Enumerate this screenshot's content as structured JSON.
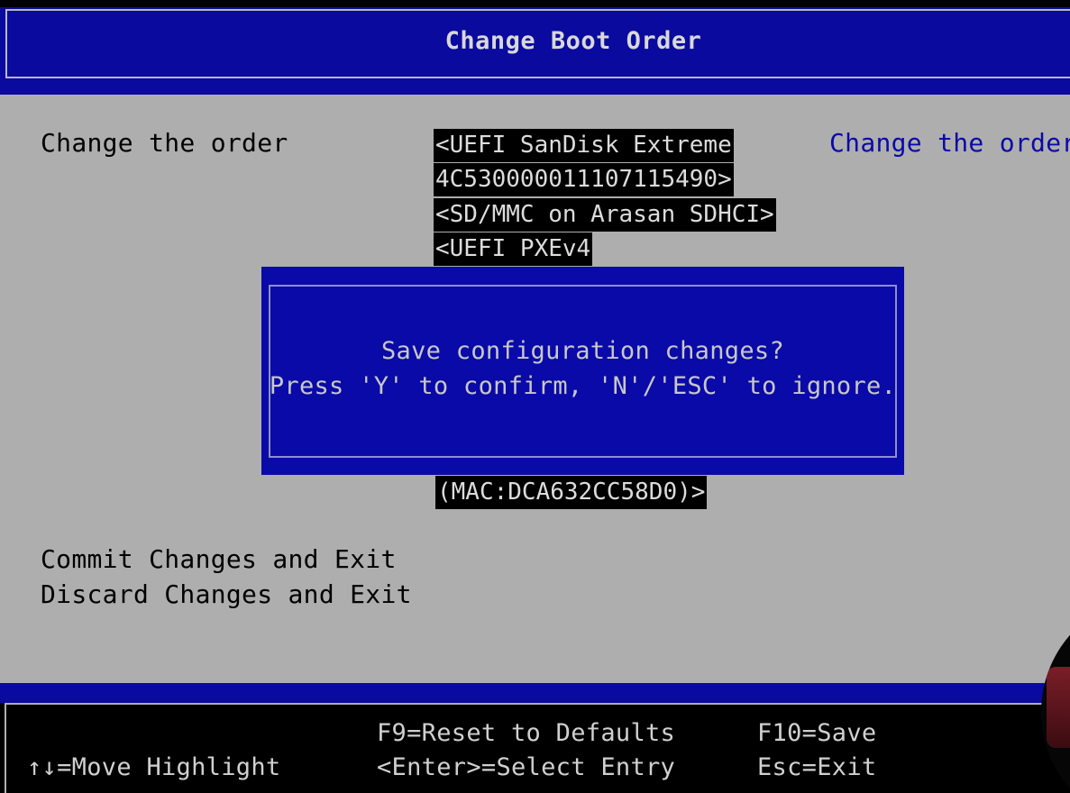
{
  "header": {
    "title": "Change Boot Order"
  },
  "form": {
    "change_order_label": "Change the order",
    "boot_order_items": [
      "<UEFI SanDisk Extreme",
      "4C530000011107115490>",
      "<SD/MMC on Arasan SDHCI>",
      "<UEFI PXEv4",
      "(MAC:DCA632CC58D0)>"
    ],
    "help_text": "Change the order",
    "commit_label": "Commit Changes and Exit",
    "discard_label": "Discard Changes and Exit"
  },
  "dialog": {
    "line1": "Save configuration changes?",
    "line2": "Press 'Y' to confirm, 'N'/'ESC' to ignore."
  },
  "footer": {
    "move_highlight": "↑↓=Move Highlight",
    "reset_defaults": "F9=Reset to Defaults",
    "select_entry": "<Enter>=Select Entry",
    "save": "F10=Save",
    "exit": "Esc=Exit"
  },
  "colors": {
    "screen_bg": "#aeaeae",
    "bar_blue": "#0a0a9e",
    "dialog_blue": "#0a0aa8",
    "help_text": "#0a0aa8",
    "highlight_bg": "#000000"
  }
}
